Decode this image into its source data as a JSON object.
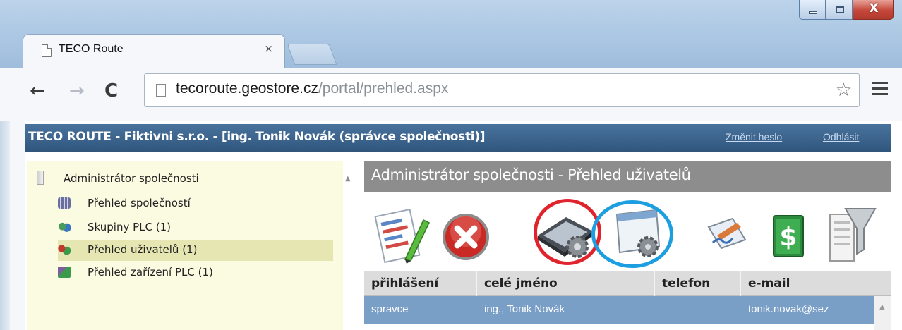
{
  "browser": {
    "tab_title": "TECO Route",
    "tab_close": "×",
    "url_host": "tecoroute.geostore.cz",
    "url_path": "/portal/prehled.aspx",
    "back": "←",
    "forward": "→",
    "reload": "C",
    "star": "☆",
    "close_window": "X"
  },
  "header": {
    "title": "TECO ROUTE - Fiktivni s.r.o. - [ing. Tonik Novák (správce společnosti)]",
    "change_password": "Změnit heslo",
    "logout": "Odhlásit"
  },
  "tree": {
    "root": "Administrátor společnosti",
    "items": [
      {
        "label": "Přehled společností",
        "icon": "companies-icon"
      },
      {
        "label": "Skupiny PLC (1)",
        "icon": "plc-groups-icon"
      },
      {
        "label": "Přehled uživatelů (1)",
        "icon": "users-icon",
        "selected": true
      },
      {
        "label": "Přehled zařízení PLC (1)",
        "icon": "plc-devices-icon"
      }
    ]
  },
  "panel": {
    "title": "Administrátor společnosti - Přehled uživatelů",
    "toolbar_icons": [
      "edit-icon",
      "delete-icon",
      "device-settings-icon",
      "window-settings-icon",
      "sign-icon",
      "money-icon",
      "filter-icon"
    ],
    "highlight_colors": {
      "red": "#e0242e",
      "blue": "#1c9ee0"
    }
  },
  "table": {
    "columns": [
      "přihlášení",
      "celé jméno",
      "telefon",
      "e-mail"
    ],
    "rows": [
      {
        "login": "spravce",
        "name": "ing., Tonik Novák",
        "phone": "",
        "email": "tonik.novak@sez"
      }
    ]
  },
  "colors": {
    "header_blue": "#30567e",
    "tree_bg": "#fbfbe1",
    "tree_selected": "#e6e6b2",
    "panel_header": "#8d8d8d",
    "row_selected": "#7a9fc7"
  }
}
